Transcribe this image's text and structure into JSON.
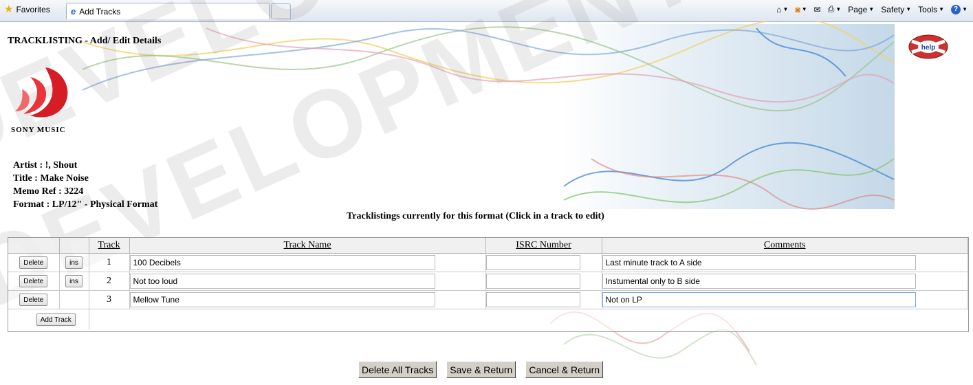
{
  "browser": {
    "favorites_label": "Favorites",
    "tab_title": "Add Tracks",
    "commands": [
      "Page",
      "Safety",
      "Tools"
    ]
  },
  "page": {
    "title": "TRACKLISTING - Add/ Edit Details",
    "logo_text": "SONY MUSIC",
    "help_label": "help",
    "watermark": "DEVELOPMENT",
    "artist": "Artist : !, Shout",
    "album_title": "Title : Make Noise",
    "memo_ref": "Memo Ref : 3224",
    "format": "Format : LP/12\" - Physical Format",
    "caption": "Tracklistings currently for this format (Click in a track to edit)"
  },
  "table": {
    "headers": {
      "track": "Track",
      "track_name": "Track Name",
      "isrc": "ISRC Number",
      "comments": "Comments"
    },
    "delete_label": "Delete",
    "ins_label": "ins",
    "add_track_label": "Add Track",
    "rows": [
      {
        "number": "1",
        "name": "100 Decibels",
        "isrc": "",
        "comments": "Last minute track to A side"
      },
      {
        "number": "2",
        "name": "Not too loud",
        "isrc": "",
        "comments": "Instumental only to B side"
      },
      {
        "number": "3",
        "name": "Mellow Tune",
        "isrc": "",
        "comments": "Not on LP"
      }
    ]
  },
  "actions": {
    "delete_all": "Delete All Tracks",
    "save_return": "Save & Return",
    "cancel_return": "Cancel & Return"
  }
}
